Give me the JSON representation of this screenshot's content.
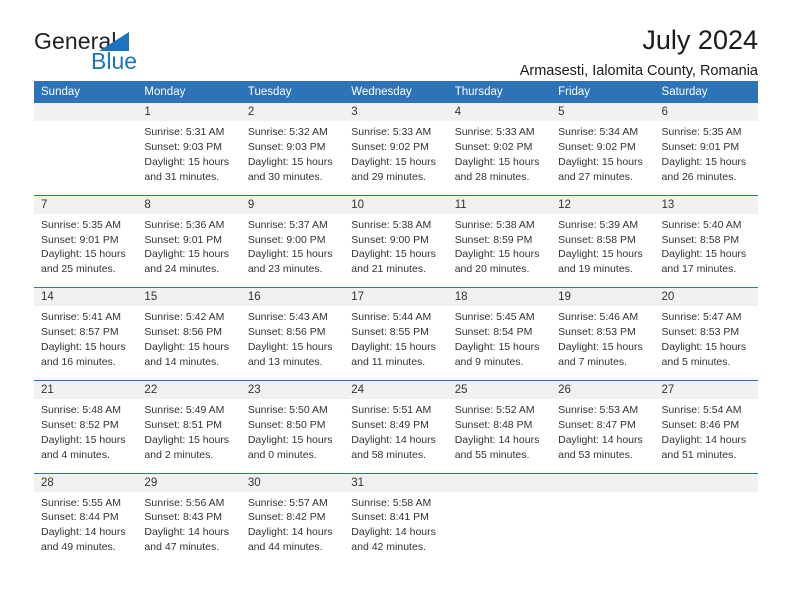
{
  "brand": {
    "name_part1": "General",
    "name_part2": "Blue"
  },
  "header": {
    "title": "July 2024",
    "subtitle": "Armasesti, Ialomita County, Romania"
  },
  "colors": {
    "header_blue": "#2e72b8",
    "logo_blue": "#1b74bd",
    "daynum_band": "#f1f1f1",
    "text": "#333333"
  },
  "weekday_headers": [
    "Sunday",
    "Monday",
    "Tuesday",
    "Wednesday",
    "Thursday",
    "Friday",
    "Saturday"
  ],
  "weeks": [
    {
      "days": [
        {
          "num": "",
          "lines": []
        },
        {
          "num": "1",
          "lines": [
            "Sunrise: 5:31 AM",
            "Sunset: 9:03 PM",
            "Daylight: 15 hours",
            "and 31 minutes."
          ]
        },
        {
          "num": "2",
          "lines": [
            "Sunrise: 5:32 AM",
            "Sunset: 9:03 PM",
            "Daylight: 15 hours",
            "and 30 minutes."
          ]
        },
        {
          "num": "3",
          "lines": [
            "Sunrise: 5:33 AM",
            "Sunset: 9:02 PM",
            "Daylight: 15 hours",
            "and 29 minutes."
          ]
        },
        {
          "num": "4",
          "lines": [
            "Sunrise: 5:33 AM",
            "Sunset: 9:02 PM",
            "Daylight: 15 hours",
            "and 28 minutes."
          ]
        },
        {
          "num": "5",
          "lines": [
            "Sunrise: 5:34 AM",
            "Sunset: 9:02 PM",
            "Daylight: 15 hours",
            "and 27 minutes."
          ]
        },
        {
          "num": "6",
          "lines": [
            "Sunrise: 5:35 AM",
            "Sunset: 9:01 PM",
            "Daylight: 15 hours",
            "and 26 minutes."
          ]
        }
      ]
    },
    {
      "days": [
        {
          "num": "7",
          "lines": [
            "Sunrise: 5:35 AM",
            "Sunset: 9:01 PM",
            "Daylight: 15 hours",
            "and 25 minutes."
          ]
        },
        {
          "num": "8",
          "lines": [
            "Sunrise: 5:36 AM",
            "Sunset: 9:01 PM",
            "Daylight: 15 hours",
            "and 24 minutes."
          ]
        },
        {
          "num": "9",
          "lines": [
            "Sunrise: 5:37 AM",
            "Sunset: 9:00 PM",
            "Daylight: 15 hours",
            "and 23 minutes."
          ]
        },
        {
          "num": "10",
          "lines": [
            "Sunrise: 5:38 AM",
            "Sunset: 9:00 PM",
            "Daylight: 15 hours",
            "and 21 minutes."
          ]
        },
        {
          "num": "11",
          "lines": [
            "Sunrise: 5:38 AM",
            "Sunset: 8:59 PM",
            "Daylight: 15 hours",
            "and 20 minutes."
          ]
        },
        {
          "num": "12",
          "lines": [
            "Sunrise: 5:39 AM",
            "Sunset: 8:58 PM",
            "Daylight: 15 hours",
            "and 19 minutes."
          ]
        },
        {
          "num": "13",
          "lines": [
            "Sunrise: 5:40 AM",
            "Sunset: 8:58 PM",
            "Daylight: 15 hours",
            "and 17 minutes."
          ]
        }
      ]
    },
    {
      "days": [
        {
          "num": "14",
          "lines": [
            "Sunrise: 5:41 AM",
            "Sunset: 8:57 PM",
            "Daylight: 15 hours",
            "and 16 minutes."
          ]
        },
        {
          "num": "15",
          "lines": [
            "Sunrise: 5:42 AM",
            "Sunset: 8:56 PM",
            "Daylight: 15 hours",
            "and 14 minutes."
          ]
        },
        {
          "num": "16",
          "lines": [
            "Sunrise: 5:43 AM",
            "Sunset: 8:56 PM",
            "Daylight: 15 hours",
            "and 13 minutes."
          ]
        },
        {
          "num": "17",
          "lines": [
            "Sunrise: 5:44 AM",
            "Sunset: 8:55 PM",
            "Daylight: 15 hours",
            "and 11 minutes."
          ]
        },
        {
          "num": "18",
          "lines": [
            "Sunrise: 5:45 AM",
            "Sunset: 8:54 PM",
            "Daylight: 15 hours",
            "and 9 minutes."
          ]
        },
        {
          "num": "19",
          "lines": [
            "Sunrise: 5:46 AM",
            "Sunset: 8:53 PM",
            "Daylight: 15 hours",
            "and 7 minutes."
          ]
        },
        {
          "num": "20",
          "lines": [
            "Sunrise: 5:47 AM",
            "Sunset: 8:53 PM",
            "Daylight: 15 hours",
            "and 5 minutes."
          ]
        }
      ]
    },
    {
      "days": [
        {
          "num": "21",
          "lines": [
            "Sunrise: 5:48 AM",
            "Sunset: 8:52 PM",
            "Daylight: 15 hours",
            "and 4 minutes."
          ]
        },
        {
          "num": "22",
          "lines": [
            "Sunrise: 5:49 AM",
            "Sunset: 8:51 PM",
            "Daylight: 15 hours",
            "and 2 minutes."
          ]
        },
        {
          "num": "23",
          "lines": [
            "Sunrise: 5:50 AM",
            "Sunset: 8:50 PM",
            "Daylight: 15 hours",
            "and 0 minutes."
          ]
        },
        {
          "num": "24",
          "lines": [
            "Sunrise: 5:51 AM",
            "Sunset: 8:49 PM",
            "Daylight: 14 hours",
            "and 58 minutes."
          ]
        },
        {
          "num": "25",
          "lines": [
            "Sunrise: 5:52 AM",
            "Sunset: 8:48 PM",
            "Daylight: 14 hours",
            "and 55 minutes."
          ]
        },
        {
          "num": "26",
          "lines": [
            "Sunrise: 5:53 AM",
            "Sunset: 8:47 PM",
            "Daylight: 14 hours",
            "and 53 minutes."
          ]
        },
        {
          "num": "27",
          "lines": [
            "Sunrise: 5:54 AM",
            "Sunset: 8:46 PM",
            "Daylight: 14 hours",
            "and 51 minutes."
          ]
        }
      ]
    },
    {
      "days": [
        {
          "num": "28",
          "lines": [
            "Sunrise: 5:55 AM",
            "Sunset: 8:44 PM",
            "Daylight: 14 hours",
            "and 49 minutes."
          ]
        },
        {
          "num": "29",
          "lines": [
            "Sunrise: 5:56 AM",
            "Sunset: 8:43 PM",
            "Daylight: 14 hours",
            "and 47 minutes."
          ]
        },
        {
          "num": "30",
          "lines": [
            "Sunrise: 5:57 AM",
            "Sunset: 8:42 PM",
            "Daylight: 14 hours",
            "and 44 minutes."
          ]
        },
        {
          "num": "31",
          "lines": [
            "Sunrise: 5:58 AM",
            "Sunset: 8:41 PM",
            "Daylight: 14 hours",
            "and 42 minutes."
          ]
        },
        {
          "num": "",
          "lines": []
        },
        {
          "num": "",
          "lines": []
        },
        {
          "num": "",
          "lines": []
        }
      ]
    }
  ]
}
